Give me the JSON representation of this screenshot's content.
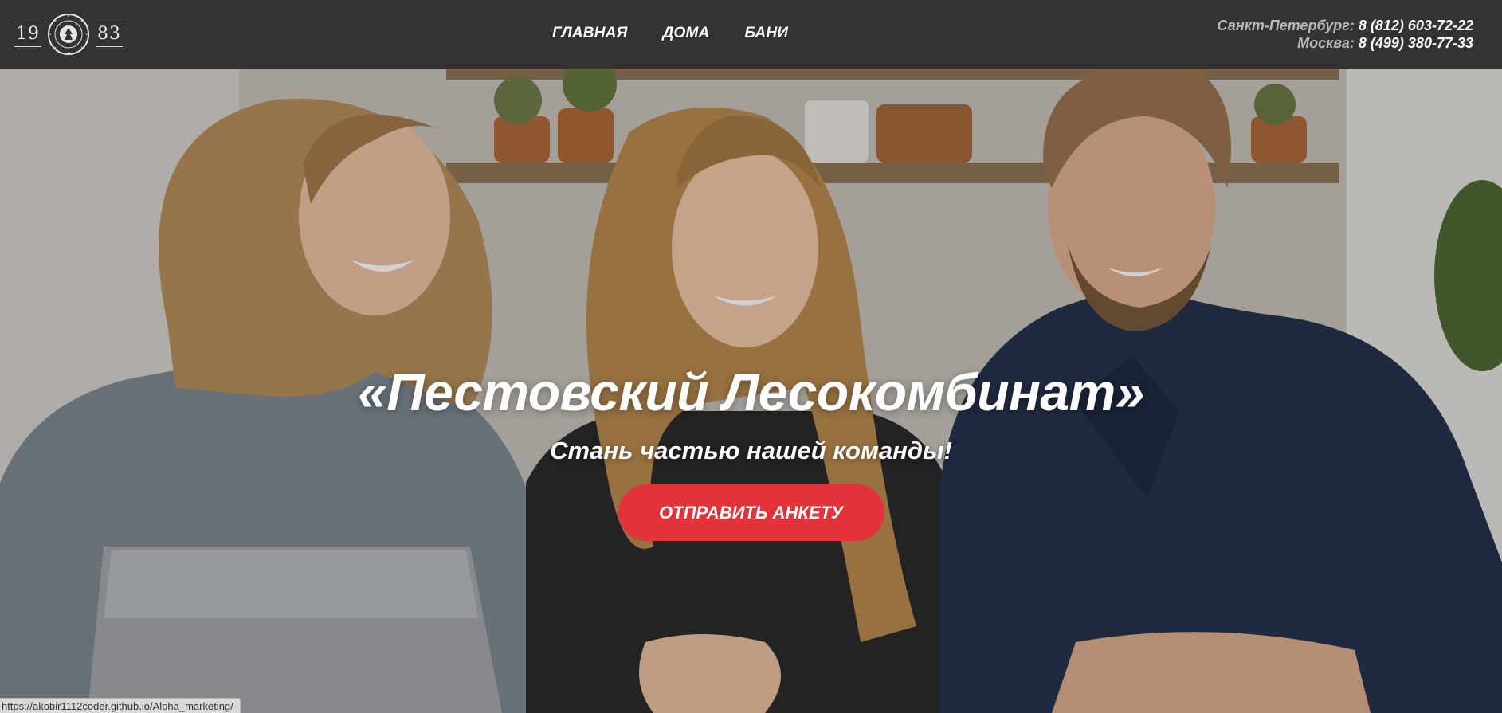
{
  "logo": {
    "year_left": "19",
    "year_right": "83",
    "seal_name": "pestovsky-seal-logo"
  },
  "nav": {
    "items": [
      "ГЛАВНАЯ",
      "ДОМА",
      "БАНИ"
    ]
  },
  "contacts": {
    "spb": {
      "city": "Санкт-Петербург:",
      "phone": "8 (812) 603-72-22"
    },
    "msk": {
      "city": "Москва:",
      "phone": "8 (499) 380-77-33"
    }
  },
  "hero": {
    "title": "«Пестовский Лесокомбинат»",
    "subtitle": "Стань частью нашей команды!",
    "cta_label": "ОТПРАВИТЬ АНКЕТУ",
    "image_name": "team-photo-three-people"
  },
  "status_bar": {
    "url": "https://akobir1112coder.github.io/Alpha_marketing/"
  },
  "colors": {
    "header_bg": "#333333",
    "accent": "#e2333b",
    "text": "#ffffff",
    "city": "#b8b8b8"
  }
}
